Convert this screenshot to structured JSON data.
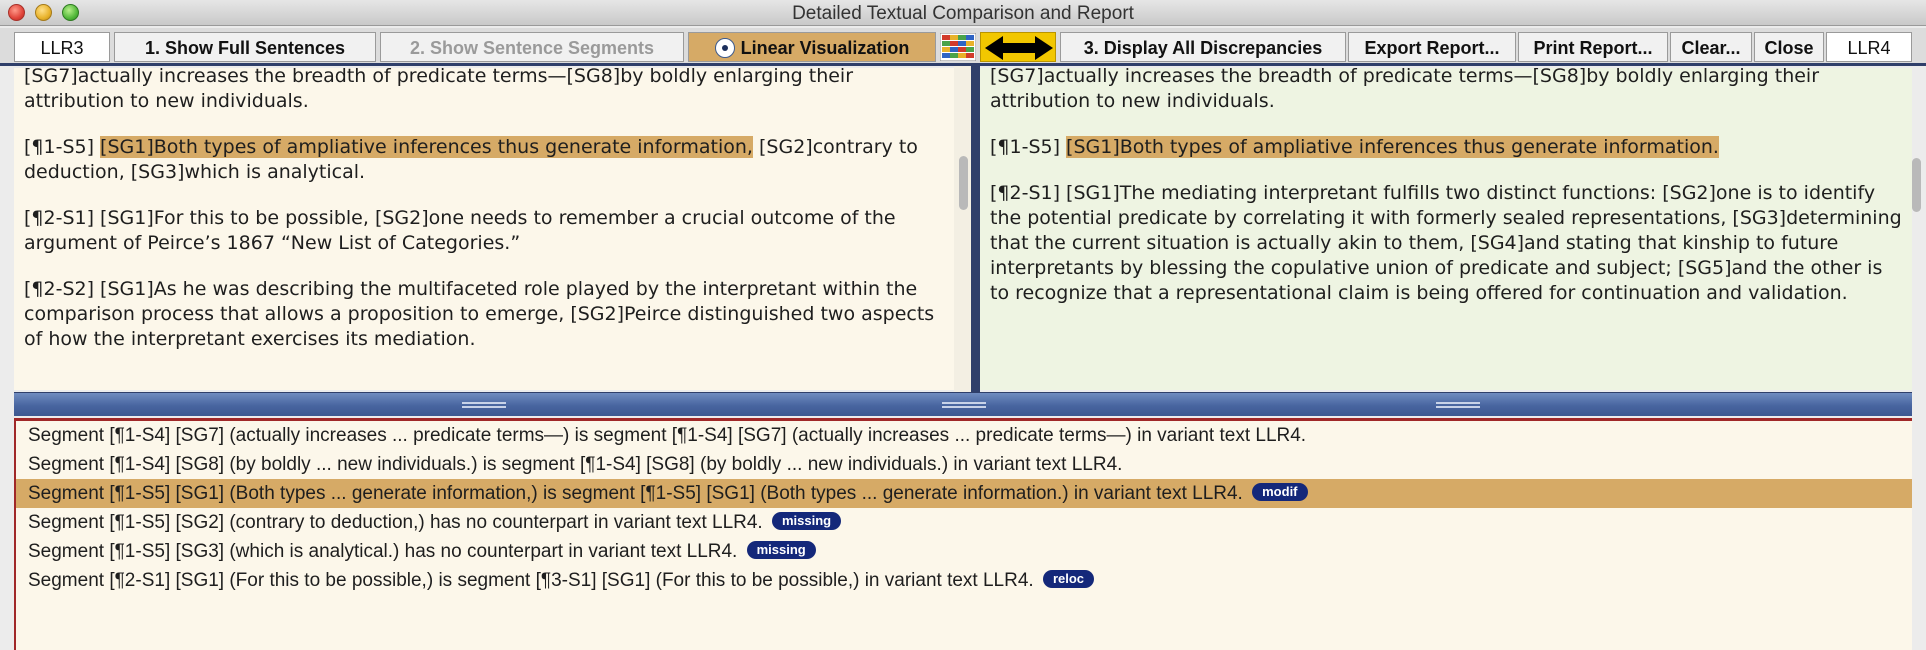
{
  "window": {
    "title": "Detailed Textual Comparison and Report"
  },
  "toolbar": {
    "left_text_label": "LLR3",
    "show_full_sentences": "1. Show Full Sentences",
    "show_sentence_segments": "2. Show Sentence Segments",
    "linear_visualization": "Linear Visualization",
    "display_all_discrepancies": "3. Display All Discrepancies",
    "export_report": "Export Report...",
    "print_report": "Print Report...",
    "clear": "Clear...",
    "close": "Close",
    "right_text_label": "LLR4"
  },
  "left_pane": {
    "paragraphs": [
      {
        "text": "[SG7]actually increases the breadth of predicate terms—[SG8]by boldly enlarging their attribution to new individuals."
      },
      {
        "prefix": "[¶1-S5] ",
        "highlight": "[SG1]Both types of ampliative inferences thus generate information,",
        "suffix": " [SG2]contrary to deduction, [SG3]which is analytical."
      },
      {
        "text": "[¶2-S1] [SG1]For this to be possible, [SG2]one needs to remember a crucial outcome of the argument of Peirce’s 1867 “New List of Categories.”"
      },
      {
        "text": "[¶2-S2] [SG1]As he was describing the multifaceted role played by the interpretant within the comparison process that allows a proposition to emerge, [SG2]Peirce distinguished two aspects of how the interpretant exercises its mediation."
      }
    ]
  },
  "right_pane": {
    "paragraphs": [
      {
        "text": "[SG7]actually increases the breadth of predicate terms—[SG8]by boldly enlarging their attribution to new individuals."
      },
      {
        "prefix": "[¶1-S5] ",
        "highlight": "[SG1]Both types of ampliative inferences thus generate information.",
        "suffix": ""
      },
      {
        "text": "[¶2-S1] [SG1]The mediating interpretant fulfills two distinct functions: [SG2]one is to identify the potential predicate by correlating it with formerly sealed representations, [SG3]determining that the current situation is actually akin to them, [SG4]and stating that kinship to future interpretants by blessing the copulative union of predicate and subject; [SG5]and the other is to recognize that a representational claim is being offered for continuation and validation."
      }
    ]
  },
  "report": {
    "lines": [
      {
        "text": "Segment [¶1-S4] [SG7] (actually increases ... predicate terms—) is segment [¶1-S4] [SG7] (actually increases ... predicate terms—) in variant text LLR4.",
        "badge": ""
      },
      {
        "text": "Segment [¶1-S4] [SG8] (by boldly ... new individuals.) is segment [¶1-S4] [SG8] (by boldly ... new individuals.) in variant text LLR4.",
        "badge": ""
      },
      {
        "text": "Segment [¶1-S5] [SG1] (Both types ... generate information,) is segment [¶1-S5] [SG1] (Both types ... generate information.) in variant text LLR4.",
        "badge": "modif"
      },
      {
        "text": "Segment [¶1-S5] [SG2] (contrary to deduction,) has no counterpart in variant text LLR4.",
        "badge": "missing"
      },
      {
        "text": "Segment [¶1-S5] [SG3] (which is analytical.) has no counterpart in variant text LLR4.",
        "badge": "missing"
      },
      {
        "text": "Segment [¶2-S1] [SG1] (For this to be possible,) is segment [¶3-S1] [SG1] (For this to be possible,) in variant text LLR4.",
        "badge": "reloc"
      }
    ]
  },
  "colors": {
    "highlight": "#d6aa66",
    "badge": "#14287a",
    "left_pane_bg": "#fcf7ea",
    "right_pane_bg": "#eef4e2",
    "splitter": "#4865a0",
    "accent_border": "#a02828"
  }
}
